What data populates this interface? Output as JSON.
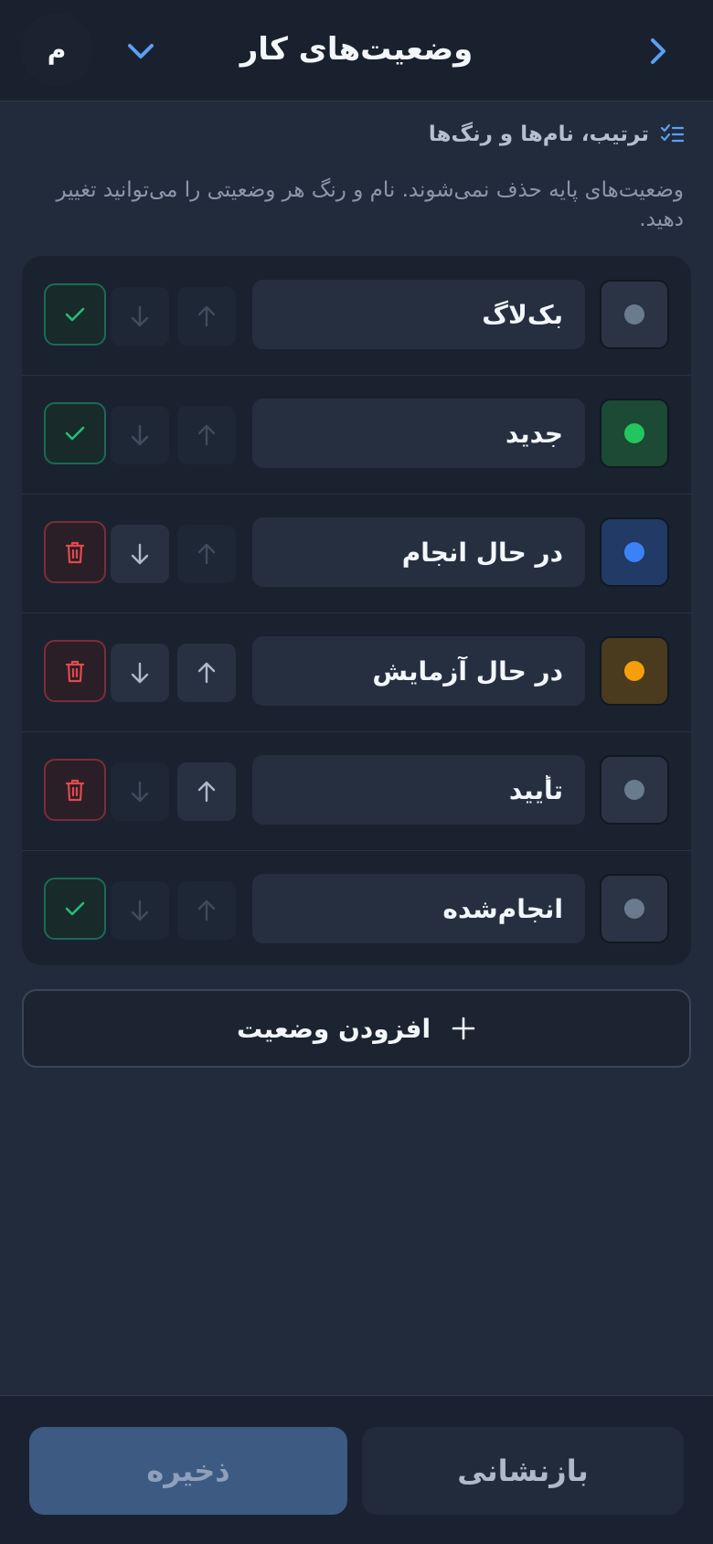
{
  "header": {
    "title": "وضعیت‌های کار",
    "avatar_initial": "م",
    "back_icon": "chevron-right-icon",
    "menu_icon": "chevron-down-icon",
    "accent": "#5aa0f2"
  },
  "section": {
    "heading": "ترتیب، نام‌ها و رنگ‌ها",
    "heading_icon": "list-check-icon",
    "description": "وضعیت‌های پایه حذف نمی‌شوند. نام و رنگ هر وضعیتی را می‌توانید تغییر دهید."
  },
  "statuses": [
    {
      "name": "بک‌لاگ",
      "color": "#6b7b8f",
      "swatch_bg": "#2a3444",
      "base": true,
      "can_up": false,
      "can_down": false
    },
    {
      "name": "جدید",
      "color": "#22c55e",
      "swatch_bg": "#1c4a34",
      "base": true,
      "can_up": false,
      "can_down": false
    },
    {
      "name": "در حال انجام",
      "color": "#3b82f6",
      "swatch_bg": "#213a66",
      "base": false,
      "can_up": false,
      "can_down": true
    },
    {
      "name": "در حال آزمایش",
      "color": "#f59e0b",
      "swatch_bg": "#4a3a1e",
      "base": false,
      "can_up": true,
      "can_down": true
    },
    {
      "name": "تأیید",
      "color": "#6b7b8f",
      "swatch_bg": "#2a3444",
      "base": false,
      "can_up": true,
      "can_down": false
    },
    {
      "name": "انجام‌شده",
      "color": "#6b7b8f",
      "swatch_bg": "#2a3444",
      "base": true,
      "can_up": false,
      "can_down": false
    }
  ],
  "actions": {
    "add_label": "افزودن وضعیت",
    "add_icon": "plus-icon"
  },
  "footer": {
    "save_label": "ذخیره",
    "reset_label": "بازنشانی"
  }
}
